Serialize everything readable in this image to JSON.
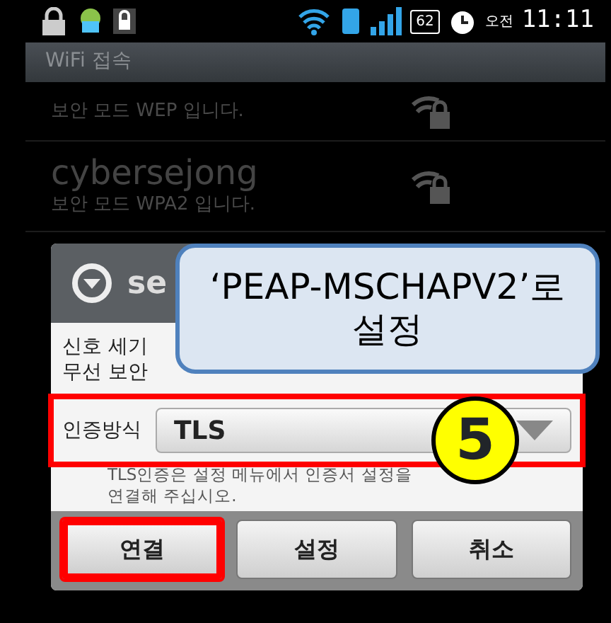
{
  "status_bar": {
    "battery": "62",
    "am_pm": "오전",
    "time": "11:11"
  },
  "title": "WiFi 접속",
  "networks": [
    {
      "security": "보안 모드 WEP 입니다."
    },
    {
      "name": "cybersejong",
      "security": "보안 모드 WPA2 입니다."
    }
  ],
  "dialog": {
    "title": "se",
    "fields": [
      {
        "label": "신호 세기"
      },
      {
        "label": "무선 보안"
      }
    ],
    "eap": {
      "label": "인증방식",
      "value": "TLS",
      "highlighted": true
    },
    "hint_lines": [
      "TLS인증은 설정 메뉴에서 인증서 설정을",
      "연결해 주십시오."
    ],
    "buttons": [
      {
        "label": "연결",
        "highlighted": true
      },
      {
        "label": "설정",
        "highlighted": false
      },
      {
        "label": "취소",
        "highlighted": false
      }
    ]
  },
  "annotations": {
    "callout": "‘PEAP-MSCHAPV2’로 설정",
    "step": "5"
  }
}
